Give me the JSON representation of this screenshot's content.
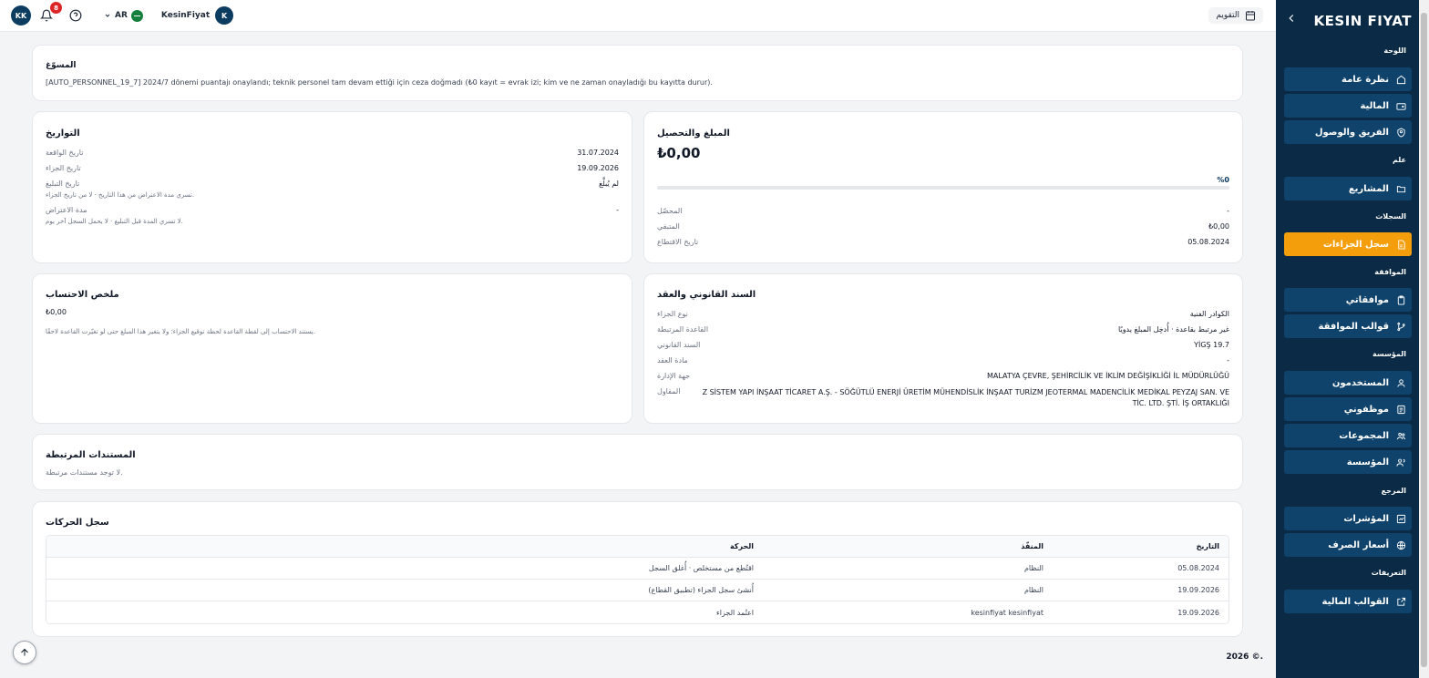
{
  "topbar": {
    "user_initials": "KK",
    "notification_count": "8",
    "language": "AR",
    "company_name": "KesinFiyat",
    "company_initial": "K",
    "calendar_label": "التقويم"
  },
  "sidebar": {
    "logo": "KESIN FIYAT",
    "sections": {
      "dashboard": "اللوحة",
      "general": "علم",
      "records": "السجلات",
      "approval": "الموافقة",
      "organization": "المؤسسة",
      "reference": "المرجع",
      "definitions": "التعريفات"
    },
    "items": [
      {
        "label": "نظرة عامة",
        "icon": "home-icon"
      },
      {
        "label": "المالية",
        "icon": "wallet-icon"
      },
      {
        "label": "الفريق والوصول",
        "icon": "shield-user-icon"
      },
      {
        "label": "المشاريع",
        "icon": "folder-icon"
      },
      {
        "label": "سجل الجزاءات",
        "icon": "file-icon"
      },
      {
        "label": "موافقاتي",
        "icon": "clipboard-icon"
      },
      {
        "label": "قوالب الموافقة",
        "icon": "branch-icon"
      },
      {
        "label": "المستخدمون",
        "icon": "user-icon"
      },
      {
        "label": "موظفوني",
        "icon": "id-card-icon"
      },
      {
        "label": "المجموعات",
        "icon": "users-icon"
      },
      {
        "label": "المؤسسة",
        "icon": "user-group-icon"
      },
      {
        "label": "المؤشرات",
        "icon": "chart-icon"
      },
      {
        "label": "أسعار الصرف",
        "icon": "globe-icon"
      },
      {
        "label": "القوالب المالية",
        "icon": "external-icon"
      }
    ],
    "active_item": "سجل الجزاءات"
  },
  "justification": {
    "title": "المسوّغ",
    "text": "[AUTO_PERSONNEL_19_7] 2024/7 dönemi puantajı onaylandı; teknik personel tam devam ettiği için ceza doğmadı (₺0 kayıt = evrak izi; kim ve ne zaman onayladığı bu kayıtta durur)."
  },
  "dates": {
    "title": "التواريخ",
    "incident_date_label": "تاريخ الواقعة",
    "incident_date": "31.07.2024",
    "penalty_date_label": "تاريخ الجزاء",
    "penalty_date": "19.09.2026",
    "notification_date_label": "تاريخ التبليغ",
    "notification_date": "لم يُبلَّغ",
    "notification_hint": "تسري مدة الاعتراض من هذا التاريخ · لا من تاريخ الجزاء.",
    "objection_period_label": "مدة الاعتراض",
    "objection_period": "-",
    "objection_hint": "لا تسري المدة قبل التبليغ · لا يحمل السجل آخر يوم."
  },
  "amount": {
    "title": "المبلغ والتحصيل",
    "total": "₺0,00",
    "percent": "%0",
    "progress": 0,
    "collected_label": "المحصّل",
    "collected": "-",
    "remaining_label": "المتبقي",
    "remaining": "₺0,00",
    "deduction_date_label": "تاريخ الاقتطاع",
    "deduction_date": "05.08.2024"
  },
  "calculation": {
    "title": "ملخص الاحتساب",
    "value": "₺0,00",
    "hint": "يستند الاحتساب إلى لقطة القاعدة لحظة توقيع الجزاء؛ ولا يتغير هذا المبلغ حتى لو تغيّرت القاعدة لاحقًا."
  },
  "legal": {
    "title": "السند القانوني والعقد",
    "penalty_type_label": "نوع الجزاء",
    "penalty_type": "الكوادر الفنية",
    "rule_label": "القاعدة المرتبطة",
    "rule": "غير مرتبط بقاعدة · أُدخِل المبلغ يدويًا",
    "legal_basis_label": "السند القانوني",
    "legal_basis": "YİGŞ 19.7",
    "contract_article_label": "مادة العقد",
    "contract_article": "-",
    "authority_label": "جهة الإدارة",
    "authority": "MALATYA ÇEVRE, ŞEHİRCİLİK VE İKLİM DEĞİŞİKLİĞİ İL MÜDÜRLÜĞÜ",
    "contractor_label": "المقاول",
    "contractor": "Z SİSTEM YAPI İNŞAAT TİCARET A.Ş. - SÖĞÜTLÜ ENERJİ ÜRETİM MÜHENDİSLİK İNŞAAT TURİZM JEOTERMAL MADENCİLİK MEDİKAL PEYZAJ SAN. VE TİC. LTD. ŞTİ. İŞ ORTAKLIĞI"
  },
  "documents": {
    "title": "المستندات المرتبطة",
    "empty": "لا توجد مستندات مرتبطة."
  },
  "history": {
    "title": "سجل الحركات",
    "columns": {
      "date": "التاريخ",
      "executor": "المنفّذ",
      "action": "الحركة"
    },
    "rows": [
      {
        "date": "05.08.2024",
        "executor": "النظام",
        "action": "اقتُطع من مستخلص · أُغلق السجل"
      },
      {
        "date": "19.09.2026",
        "executor": "النظام",
        "action": "أُنشئ سجل الجزاء (تطبيق القطاع)"
      },
      {
        "date": "19.09.2026",
        "executor": "kesinfiyat kesinfiyat",
        "action": "اعتُمد الجزاء"
      }
    ]
  },
  "footer": {
    "copyright": "2026 ©."
  }
}
